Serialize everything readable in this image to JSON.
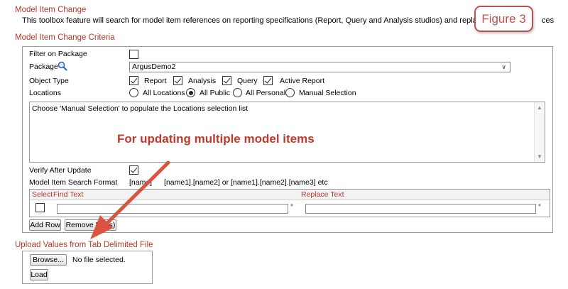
{
  "headings": {
    "model_item_change": "Model Item Change",
    "criteria": "Model Item Change Criteria",
    "upload": "Upload Values from Tab Delimited File"
  },
  "description": "This toolbox feature will search for model item references on reporting specifications (Report, Query and Analysis studios) and replace/mo",
  "description_tail": "ces",
  "figure_label": "Figure 3",
  "form": {
    "filter_on_package_label": "Filter on Package",
    "filter_on_package_checked": false,
    "package_label": "Package",
    "package_value": "ArgusDemo2",
    "object_type_label": "Object Type",
    "object_types": [
      {
        "label": "Report",
        "checked": true
      },
      {
        "label": "Analysis",
        "checked": true
      },
      {
        "label": "Query",
        "checked": true
      },
      {
        "label": "Active Report",
        "checked": true
      }
    ],
    "locations_label": "Locations",
    "locations": [
      {
        "label": "All Locations",
        "selected": false
      },
      {
        "label": "All Public",
        "selected": true
      },
      {
        "label": "All Personal",
        "selected": false
      },
      {
        "label": "Manual Selection",
        "selected": false
      }
    ],
    "locations_list_text": "Choose 'Manual Selection' to populate the Locations selection list",
    "verify_label": "Verify After Update",
    "verify_checked": true,
    "search_format_label": "Model Item Search Format",
    "search_format_value_a": "[name]",
    "search_format_value_b": "[name1].[name2] or [name1].[name2].[name3] etc",
    "grid": {
      "col_select": "Select",
      "col_find": "Find Text",
      "col_replace": "Replace Text",
      "required_marker": "*"
    },
    "add_row_label": "Add Row",
    "remove_row_label": "Remove R",
    "remove_row_tail": "(s)"
  },
  "annotation": "For updating multiple model items",
  "upload": {
    "browse_label": "Browse...",
    "file_status": "No file selected.",
    "load_label": "Load"
  },
  "colors": {
    "heading": "#b33a2a",
    "annotation": "#c0392b",
    "arrow": "#d9533f"
  }
}
